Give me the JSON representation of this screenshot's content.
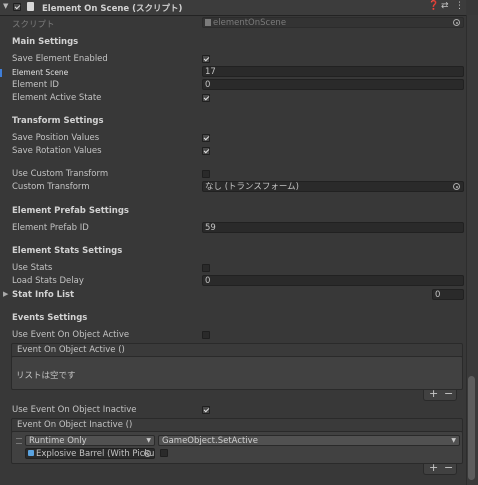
{
  "header": {
    "title": "Element On Scene (スクリプト)",
    "fold_glyph": "▼",
    "icons": [
      "help-icon",
      "preset-icon",
      "more-options-icon"
    ],
    "icon_glyphs": [
      "❓",
      "⇄",
      "⋮"
    ]
  },
  "script": {
    "label": "スクリプト",
    "value": "elementOnScene"
  },
  "main": {
    "title": "Main Settings",
    "save_element_enabled": "Save Element Enabled",
    "element_scene_label": "Element Scene",
    "element_scene_value": "17",
    "element_id_label": "Element ID",
    "element_id_value": "0",
    "element_active_state": "Element Active State"
  },
  "transform": {
    "title": "Transform Settings",
    "save_position": "Save Position Values",
    "save_rotation": "Save Rotation Values",
    "use_custom": "Use Custom Transform",
    "custom_label": "Custom Transform",
    "custom_value": "なし (トランスフォーム)"
  },
  "prefab": {
    "title": "Element Prefab Settings",
    "id_label": "Element Prefab ID",
    "id_value": "59"
  },
  "stats": {
    "title": "Element Stats Settings",
    "use_stats": "Use Stats",
    "load_delay_label": "Load Stats Delay",
    "load_delay_value": "0",
    "stat_info_label": "Stat Info List",
    "stat_info_count": "0"
  },
  "events": {
    "title": "Events Settings",
    "use_active": "Use Event On Object Active",
    "active_event_title": "Event On Object Active ()",
    "active_empty": "リストは空です",
    "use_inactive": "Use Event On Object Inactive",
    "inactive_event_title": "Event On Object Inactive ()",
    "runtime_option": "Runtime Only",
    "function_option": "GameObject.SetActive",
    "target_object": "Explosive Barrel (With Pickup)",
    "plus": "+",
    "minus": "−"
  }
}
